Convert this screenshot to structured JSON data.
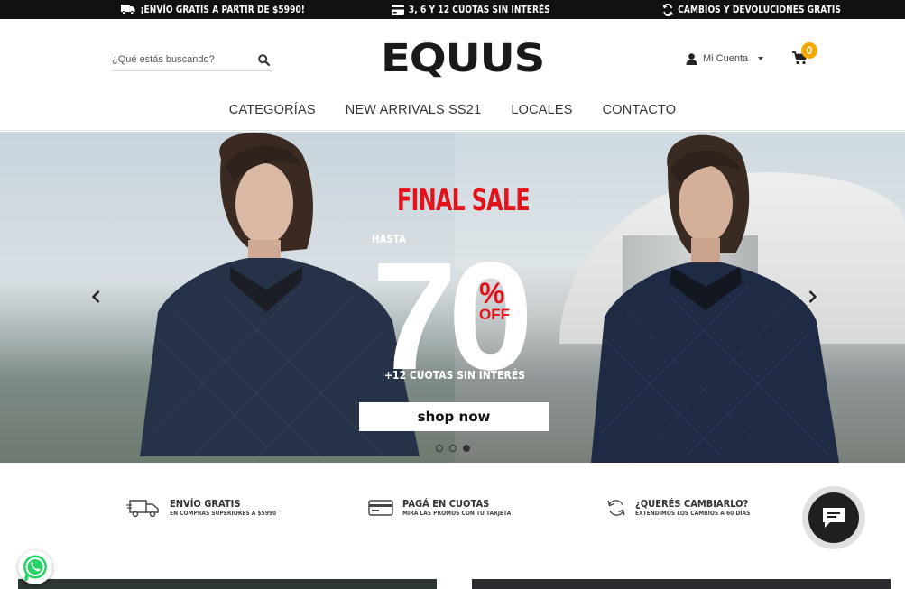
{
  "promo_bar": {
    "items": [
      {
        "label": "¡ENVÍO GRATIS A PARTIR DE $5990!",
        "icon": "truck-icon"
      },
      {
        "label": "3, 6 Y 12 CUOTAS SIN INTERÉS",
        "icon": "credit-card-icon"
      },
      {
        "label": "CAMBIOS Y DEVOLUCIONES GRATIS",
        "icon": "refresh-icon"
      }
    ]
  },
  "header": {
    "search": {
      "placeholder": "¿Qué estás buscando?",
      "icon": "search-icon"
    },
    "logo": "EQUUS",
    "account": {
      "label": "Mi Cuenta",
      "icon": "user-icon"
    },
    "cart": {
      "count": "0",
      "icon": "cart-icon"
    },
    "nav": [
      "CATEGORÍAS",
      "NEW ARRIVALS SS21",
      "LOCALES",
      "CONTACTO"
    ]
  },
  "hero": {
    "headline": "FINAL SALE",
    "prefix": "HASTA",
    "number": "70",
    "percent": "%",
    "off": "OFF",
    "installments": "+12 CUOTAS SIN INTERÉS",
    "cta": "shop now",
    "slides_total": 3,
    "active_slide": 3
  },
  "benefits": [
    {
      "title": "ENVÍO GRATIS",
      "subtitle": "EN COMPRAS SUPERIORES A $5990",
      "icon": "truck-icon"
    },
    {
      "title": "PAGÁ EN CUOTAS",
      "subtitle": "MIRÁ LAS PROMOS CON TU TARJETA",
      "icon": "credit-card-icon"
    },
    {
      "title": "¿QUERÉS CAMBIARLO?",
      "subtitle": "EXTENDIMOS LOS CAMBIOS A 60 DÍAS",
      "icon": "refresh-icon"
    }
  ],
  "colors": {
    "accent_red": "#e3131b",
    "badge_yellow": "#f2a900",
    "promo_bg": "#111111"
  }
}
